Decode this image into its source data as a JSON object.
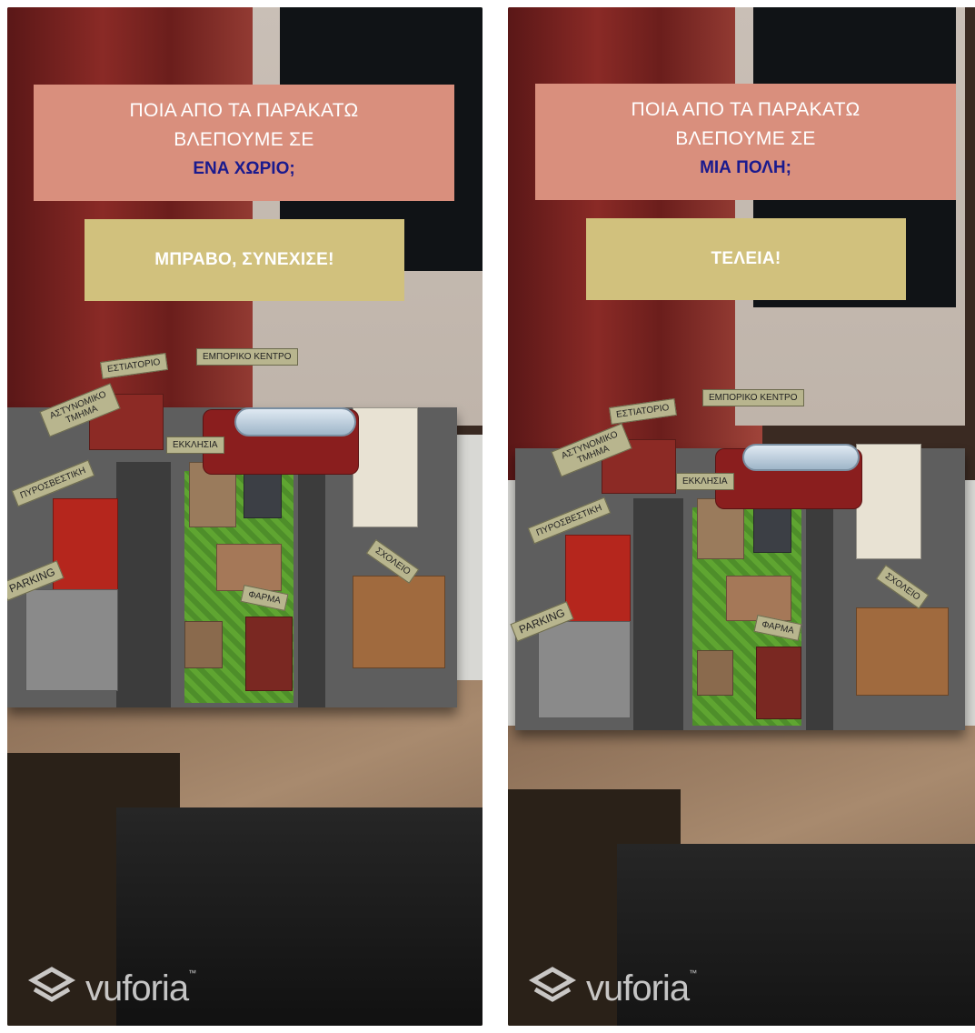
{
  "screens": [
    {
      "question": {
        "line1": "ΠΟΙΑ ΑΠΟ ΤΑ ΠΑΡΑΚΑΤΩ",
        "line2": "ΒΛΕΠΟΥΜΕ ΣΕ",
        "highlight": "ΕΝΑ ΧΩΡΙΟ;"
      },
      "feedback": "ΜΠΡΑΒΟ, ΣΥΝΕΧΙΣΕ!",
      "labels": {
        "restaurant": "ΕΣΤΙΑΤΟΡΙΟ",
        "mall": "ΕΜΠΟΡΙΚΟ ΚΕΝΤΡΟ",
        "police": "ΑΣΤΥΝΟΜΙΚΟ ΤΜΗΜΑ",
        "church": "ΕΚΚΛΗΣΙΑ",
        "fire": "ΠΥΡΟΣΒΕΣΤΙΚΗ",
        "school": "ΣΧΟΛΕΙΟ",
        "parking": "PARKING",
        "farm": "ΦΑΡΜΑ"
      }
    },
    {
      "question": {
        "line1": "ΠΟΙΑ ΑΠΟ ΤΑ ΠΑΡΑΚΑΤΩ",
        "line2": "ΒΛΕΠΟΥΜΕ ΣΕ",
        "highlight": "ΜΙΑ ΠΟΛΗ;"
      },
      "feedback": "ΤΕΛΕΙΑ!",
      "labels": {
        "restaurant": "ΕΣΤΙΑΤΟΡΙΟ",
        "mall": "ΕΜΠΟΡΙΚΟ ΚΕΝΤΡΟ",
        "police": "ΑΣΤΥΝΟΜΙΚΟ ΤΜΗΜΑ",
        "church": "ΕΚΚΛΗΣΙΑ",
        "fire": "ΠΥΡΟΣΒΕΣΤΙΚΗ",
        "school": "ΣΧΟΛΕΙΟ",
        "parking": "PARKING",
        "farm": "ΦΑΡΜΑ"
      }
    }
  ],
  "brand": {
    "name": "vuforia",
    "tm": "™",
    "icon": "vuforia-logo-icon"
  },
  "colors": {
    "question_bg": "#d98f7d",
    "highlight": "#1a1a8e",
    "feedback_bg": "#d1c17d"
  }
}
